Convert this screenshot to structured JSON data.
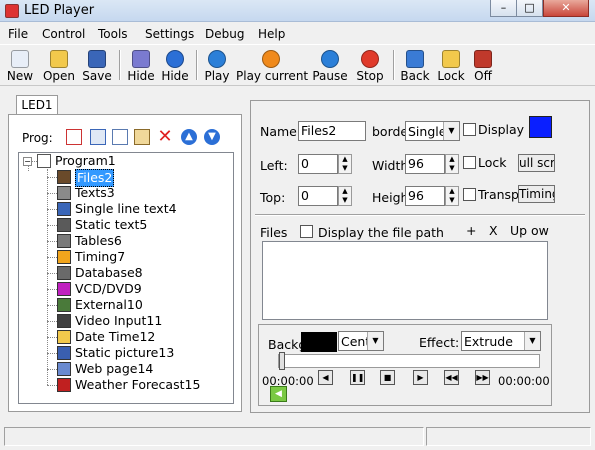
{
  "window": {
    "title": "LED Player",
    "minimize": "–",
    "maximize": "□",
    "close": "✕"
  },
  "menu": [
    "File",
    "Control",
    "Tools",
    "Settings",
    "Debug",
    "Help"
  ],
  "toolbar": [
    {
      "label": "New",
      "icon": "new-icon",
      "color": "#e8eef8"
    },
    {
      "label": "Open",
      "icon": "open-folder-icon",
      "color": "#f2c94c"
    },
    {
      "label": "Save",
      "icon": "save-icon",
      "color": "#3a66b8"
    },
    {
      "label": "Hide",
      "icon": "edit-hide-icon",
      "color": "#7a7ad0"
    },
    {
      "label": "Hide",
      "icon": "blue-hide-icon",
      "color": "#2b6fd6"
    },
    {
      "label": "Play",
      "icon": "play-icon",
      "color": "#2b7fd8"
    },
    {
      "label": "Play current",
      "icon": "play-current-icon",
      "color": "#f08a1c"
    },
    {
      "label": "Pause",
      "icon": "pause-icon",
      "color": "#2b7fd8"
    },
    {
      "label": "Stop",
      "icon": "stop-icon",
      "color": "#e03a2a"
    },
    {
      "label": "Back",
      "icon": "back-monitor-icon",
      "color": "#3a7bd5"
    },
    {
      "label": "Lock",
      "icon": "lock-icon",
      "color": "#f2c94c"
    },
    {
      "label": "Off",
      "icon": "off-icon",
      "color": "#c0392b"
    }
  ],
  "tab": "LED1",
  "prog_label": "Prog:",
  "tree": {
    "root": "Program1",
    "items": [
      {
        "label": "Files2",
        "icon": "files-icon",
        "color": "#6a4a2a",
        "selected": true
      },
      {
        "label": "Texts3",
        "icon": "texts-icon",
        "color": "#8a8a8a"
      },
      {
        "label": "Single line text4",
        "icon": "single-line-text-icon",
        "color": "#3a66b8"
      },
      {
        "label": "Static text5",
        "icon": "static-text-icon",
        "color": "#5a5a5a"
      },
      {
        "label": "Tables6",
        "icon": "table-icon",
        "color": "#7a7a7a"
      },
      {
        "label": "Timing7",
        "icon": "timing-clock-icon",
        "color": "#f2a51c"
      },
      {
        "label": "Database8",
        "icon": "database-icon",
        "color": "#6a6a6a"
      },
      {
        "label": "VCD/DVD9",
        "icon": "vcd-dvd-icon",
        "color": "#c020c0"
      },
      {
        "label": "External10",
        "icon": "external-icon",
        "color": "#4a7a3a"
      },
      {
        "label": "Video Input11",
        "icon": "video-input-icon",
        "color": "#404040"
      },
      {
        "label": "Date Time12",
        "icon": "date-time-clock-icon",
        "color": "#f2c94c"
      },
      {
        "label": "Static picture13",
        "icon": "static-picture-icon",
        "color": "#3a5fb0"
      },
      {
        "label": "Web page14",
        "icon": "web-page-icon",
        "color": "#6a8ad0"
      },
      {
        "label": "Weather Forecast15",
        "icon": "weather-forecast-icon",
        "color": "#c02020"
      }
    ]
  },
  "props": {
    "name_label": "Name:",
    "name_value": "Files2",
    "border_label": "borde",
    "border_value": "Single",
    "display_bg_label": "Display b",
    "bg_color": "#0a1fff",
    "left_label": "Left:",
    "left_value": "0",
    "width_label": "Width",
    "width_value": "96",
    "lock_label": "Lock",
    "fullscreen_button": "ull scree",
    "top_label": "Top:",
    "top_value": "0",
    "height_label": "Heigh",
    "height_value": "96",
    "transparent_label": "Transpa",
    "timing_button": "Timing"
  },
  "files": {
    "label": "Files",
    "display_path_label": "Display the file path",
    "add": "+",
    "remove": "X",
    "up": "Up",
    "down": "ow"
  },
  "playback": {
    "background_label": "Backg",
    "background_color": "#000000",
    "align_value": "Cent",
    "effect_label": "Effect:",
    "effect_value": "Extrude",
    "time_start": "00:00:00",
    "time_end": "00:00:00",
    "slider_position": 0
  }
}
